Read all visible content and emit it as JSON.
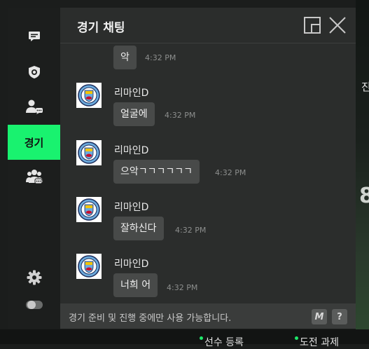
{
  "background": {
    "right_label": "진",
    "right_number": "8",
    "bottom_tabs": [
      "선수 등록",
      "도전 과제"
    ]
  },
  "sidebar": {
    "items": [
      {
        "name": "chat-icon"
      },
      {
        "name": "shield-icon"
      },
      {
        "name": "user-chat-icon"
      },
      {
        "label": "경기",
        "active": true
      },
      {
        "name": "group-chat-icon"
      }
    ],
    "settings_icon": "gear-icon",
    "toggle_icon": "toggle-icon"
  },
  "header": {
    "title": "경기 채팅",
    "popout_icon": "popout-window-icon",
    "close_icon": "close-icon"
  },
  "messages": [
    {
      "sender": "",
      "text": "악",
      "time": "4:32 PM",
      "show_avatar": false
    },
    {
      "sender": "리마인D",
      "text": "얼굴에",
      "time": "4:32 PM",
      "show_avatar": true
    },
    {
      "sender": "리마인D",
      "text": "으악ㄱㄱㄱㄱㄱㄱ",
      "time": "4:32 PM",
      "show_avatar": true
    },
    {
      "sender": "리마인D",
      "text": "잘하신다",
      "time": "4:32 PM",
      "show_avatar": true
    },
    {
      "sender": "리마인D",
      "text": "너희 어",
      "time": "4:32 PM",
      "show_avatar": true
    }
  ],
  "footer": {
    "notice": "경기 준비 및 진행 중에만 사용 가능합니다.",
    "macro_key": "M",
    "help_key": "?"
  },
  "colors": {
    "accent": "#19f26f",
    "panel": "#2b2d2c",
    "sidebar": "#1c1e1d",
    "bubble": "#484a49"
  }
}
